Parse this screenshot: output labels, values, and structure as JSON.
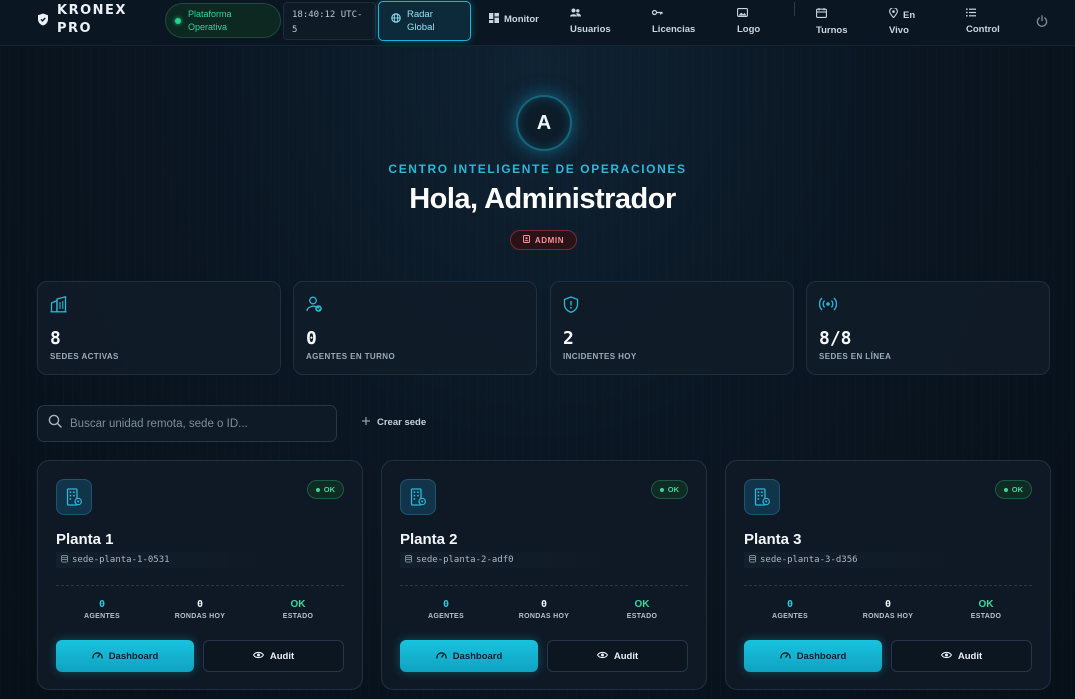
{
  "brand": {
    "line1": "KRONEX",
    "line2": "PRO"
  },
  "status_pill": {
    "line1": "Plataforma",
    "line2": "Operativa"
  },
  "clock": {
    "line1": "18:40:12 UTC-",
    "line2": "5"
  },
  "radar": {
    "line1": "Radar",
    "line2": "Global"
  },
  "nav": {
    "monitor": "Monitor",
    "usuarios": "Usuarios",
    "licencias": "Licencias",
    "logo": "Logo",
    "turnos": "Turnos",
    "en_vivo_1": "En",
    "en_vivo_2": "Vivo",
    "control": "Control"
  },
  "hero": {
    "avatar_letter": "A",
    "eyebrow": "CENTRO INTELIGENTE DE OPERACIONES",
    "greeting": "Hola, Administrador",
    "role": "ADMIN"
  },
  "stats": [
    {
      "value": "8",
      "label": "SEDES ACTIVAS",
      "icon": "building-chart-icon"
    },
    {
      "value": "0",
      "label": "AGENTES EN TURNO",
      "icon": "user-check-icon"
    },
    {
      "value": "2",
      "label": "INCIDENTES HOY",
      "icon": "shield-alert-icon"
    },
    {
      "value": "8/8",
      "label": "SEDES EN LÍNEA",
      "icon": "broadcast-icon"
    }
  ],
  "search": {
    "placeholder": "Buscar unidad remota, sede o ID..."
  },
  "create_label": "Crear sede",
  "sites": [
    {
      "name": "Planta 1",
      "id": "sede-planta-1-0531",
      "status": "OK",
      "agentes": "0",
      "rondas": "0",
      "estado": "OK"
    },
    {
      "name": "Planta 2",
      "id": "sede-planta-2-adf0",
      "status": "OK",
      "agentes": "0",
      "rondas": "0",
      "estado": "OK"
    },
    {
      "name": "Planta 3",
      "id": "sede-planta-3-d356",
      "status": "OK",
      "agentes": "0",
      "rondas": "0",
      "estado": "OK"
    }
  ],
  "site_labels": {
    "agentes": "AGENTES",
    "rondas": "RONDAS HOY",
    "estado": "ESTADO",
    "dashboard": "Dashboard",
    "audit": "Audit"
  },
  "colors": {
    "accent": "#19c3de",
    "ok": "#37d79c",
    "danger": "#ff8e99",
    "bg": "#0a1622"
  }
}
